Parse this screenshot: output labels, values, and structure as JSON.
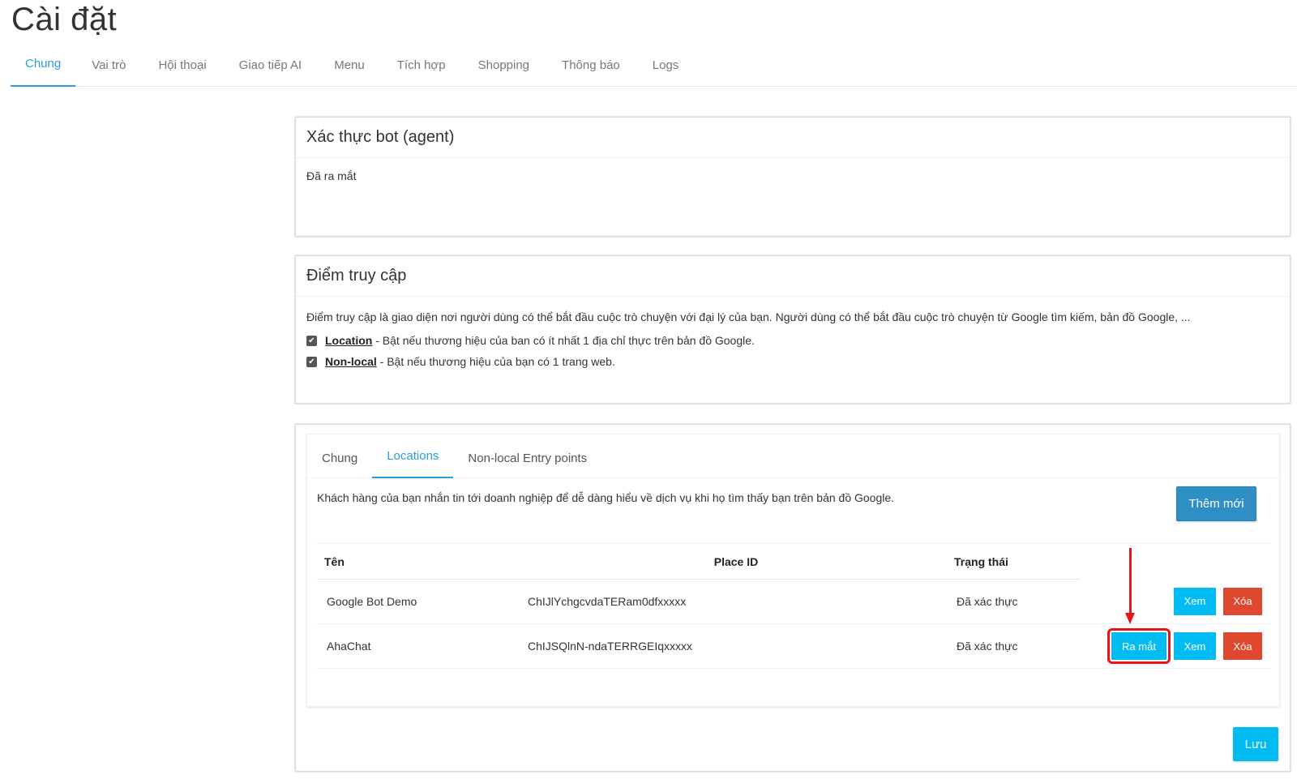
{
  "page": {
    "title": "Cài đặt"
  },
  "top_tabs": [
    {
      "label": "Chung",
      "active": true
    },
    {
      "label": "Vai trò"
    },
    {
      "label": "Hội thoại"
    },
    {
      "label": "Giao tiếp AI"
    },
    {
      "label": "Menu"
    },
    {
      "label": "Tích hợp"
    },
    {
      "label": "Shopping"
    },
    {
      "label": "Thông báo"
    },
    {
      "label": "Logs"
    }
  ],
  "verify_panel": {
    "title": "Xác thực bot (agent)",
    "status": "Đã ra mắt"
  },
  "entry_panel": {
    "title": "Điểm truy cập",
    "description": "Điểm truy cập là giao diện nơi người dùng có thể bắt đầu cuộc trò chuyện với đại lý của bạn. Người dùng có thể bắt đầu cuộc trò chuyện từ Google tìm kiếm, bản đồ Google, ...",
    "options": [
      {
        "label": "Location",
        "text": " - Bật nếu thương hiệu của ban có ít nhất 1 địa chỉ thực trên bản đồ Google.",
        "checked": true,
        "check_icon": "checkmark-icon"
      },
      {
        "label": "Non-local",
        "text": " - Bật nếu thương hiệu của bạn có 1 trang web.",
        "checked": true,
        "check_icon": "checkmark-icon"
      }
    ]
  },
  "locations_panel": {
    "tabs": [
      {
        "label": "Chung"
      },
      {
        "label": "Locations",
        "active": true
      },
      {
        "label": "Non-local Entry points"
      }
    ],
    "description": "Khách hàng của bạn nhắn tin tới doanh nghiệp để dễ dàng hiểu về dịch vụ khi họ tìm thấy bạn trên bản đồ Google.",
    "add_button": "Thêm mới",
    "columns": {
      "name": "Tên",
      "place_id": "Place ID",
      "status": "Trạng thái"
    },
    "rows": [
      {
        "name": "Google Bot Demo",
        "place_id": "ChIJlYchgcvdaTERam0dfxxxxx",
        "status": "Đã xác thực",
        "view": "Xem",
        "delete": "Xóa"
      },
      {
        "name": "AhaChat",
        "place_id": "ChIJSQlnN-ndaTERRGEIqxxxxx",
        "status": "Đã xác thực",
        "launch": "Ra mắt",
        "view": "Xem",
        "delete": "Xóa"
      }
    ],
    "save_button": "Lưu"
  },
  "colors": {
    "accent": "#2a9fd6",
    "button_info": "#00bcf2",
    "button_danger": "#e0472f",
    "button_primary": "#2f8fc4",
    "highlight": "#e8131b"
  }
}
